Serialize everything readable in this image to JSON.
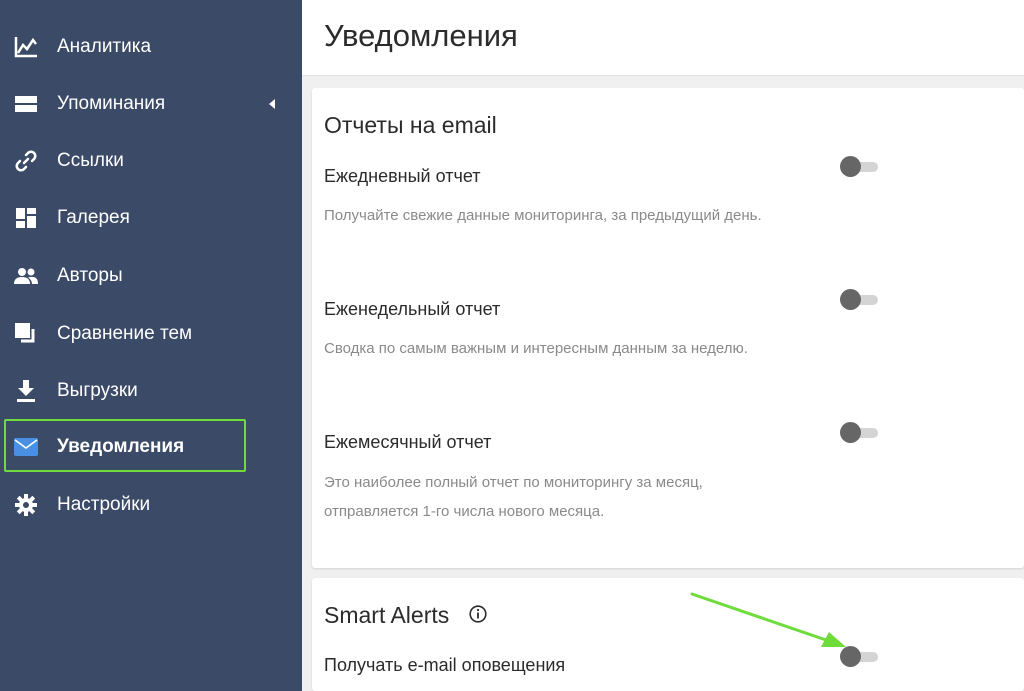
{
  "sidebar": {
    "items": [
      {
        "label": "Аналитика",
        "icon": "chart-line-icon"
      },
      {
        "label": "Упоминания",
        "icon": "mentions-icon",
        "has_caret": true
      },
      {
        "label": "Ссылки",
        "icon": "link-icon"
      },
      {
        "label": "Галерея",
        "icon": "gallery-icon"
      },
      {
        "label": "Авторы",
        "icon": "authors-icon"
      },
      {
        "label": "Сравнение тем",
        "icon": "compare-icon"
      },
      {
        "label": "Выгрузки",
        "icon": "download-icon"
      },
      {
        "label": "Уведомления",
        "icon": "envelope-icon",
        "active": true
      },
      {
        "label": "Настройки",
        "icon": "gear-icon"
      }
    ]
  },
  "header": {
    "title": "Уведомления"
  },
  "email_reports": {
    "title": "Отчеты на email",
    "daily": {
      "title": "Ежедневный отчет",
      "description": "Получайте свежие данные мониторинга, за предыдущий день.",
      "enabled": false
    },
    "weekly": {
      "title": "Еженедельный отчет",
      "description": "Сводка по самым важным и интересным данным за неделю.",
      "enabled": false
    },
    "monthly": {
      "title": "Ежемесячный отчет",
      "description": "Это наиболее полный отчет по мониторингу за месяц, отправляется 1-го числа нового месяца.",
      "enabled": false
    }
  },
  "smart_alerts": {
    "title": "Smart Alerts",
    "email_alerts": {
      "title": "Получать e-mail оповещения",
      "enabled": false
    }
  },
  "colors": {
    "sidebar_bg": "#3a4a67",
    "highlight_border": "#6fdc3c",
    "active_icon": "#4a90e2",
    "toggle_knob": "#666666",
    "toggle_track": "#d4d4d4",
    "annotation_arrow": "#6fdc3c"
  }
}
